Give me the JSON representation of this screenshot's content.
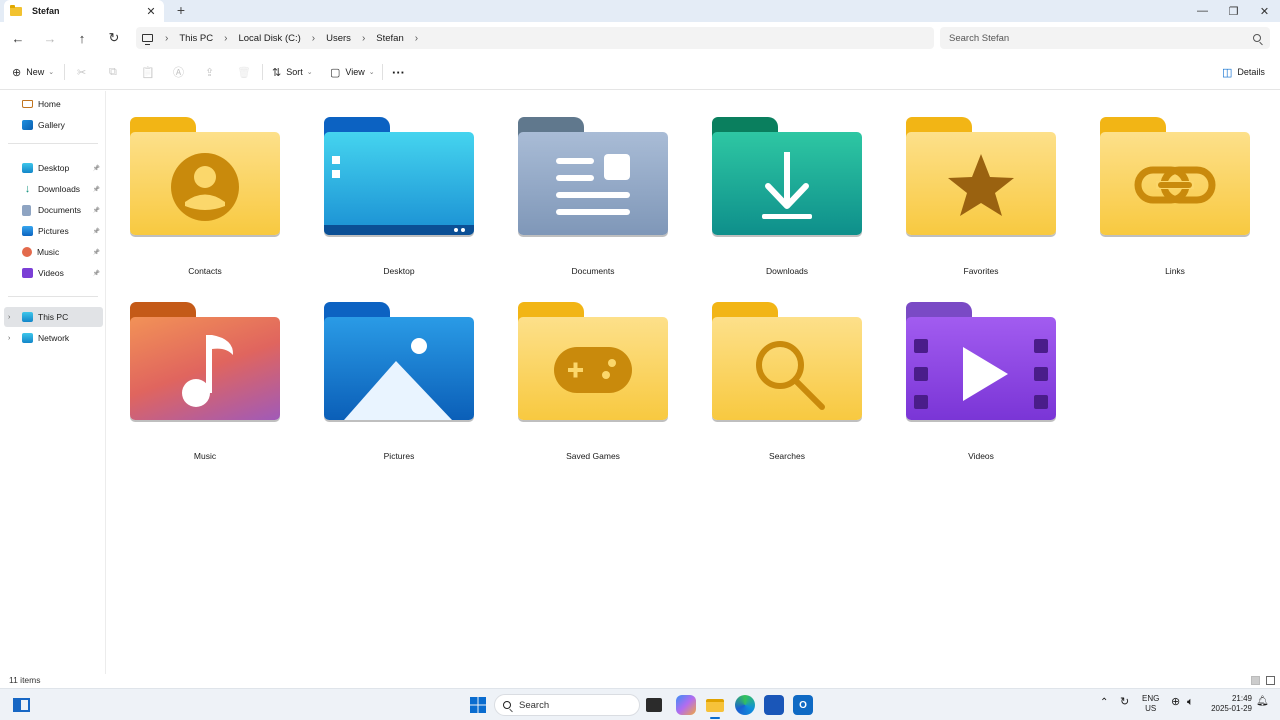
{
  "window": {
    "tab_title": "Stefan",
    "tab_close": "✕",
    "new_tab": "+",
    "minimize": "—",
    "maximize": "❐",
    "close": "✕"
  },
  "address_bar": {
    "back": "←",
    "forward": "→",
    "up": "↑",
    "refresh": "↻",
    "breadcrumbs": [
      "This PC",
      "Local Disk (C:)",
      "Users",
      "Stefan"
    ],
    "separator": "›",
    "search_placeholder": "Search Stefan"
  },
  "command_bar": {
    "new_label": "New",
    "sort_label": "Sort",
    "view_label": "View",
    "more": "···",
    "details_label": "Details",
    "icons": {
      "new": "⊕",
      "cut": "✂",
      "copy": "⧉",
      "paste": "📋",
      "rename": "Ⓐ",
      "share": "⇪",
      "delete": "🗑",
      "sort": "⇅",
      "view": "▢",
      "details": "◫"
    }
  },
  "nav_pane": {
    "home": "Home",
    "gallery": "Gallery",
    "quick_access": [
      "Desktop",
      "Downloads",
      "Documents",
      "Pictures",
      "Music",
      "Videos"
    ],
    "this_pc": "This PC",
    "network": "Network",
    "pin": "📌",
    "expander": "›"
  },
  "folders": [
    {
      "name": "Contacts",
      "icon": "contacts-icon"
    },
    {
      "name": "Desktop",
      "icon": "desktop-icon"
    },
    {
      "name": "Documents",
      "icon": "documents-icon"
    },
    {
      "name": "Downloads",
      "icon": "downloads-icon"
    },
    {
      "name": "Favorites",
      "icon": "star-icon"
    },
    {
      "name": "Links",
      "icon": "link-icon"
    },
    {
      "name": "Music",
      "icon": "music-icon"
    },
    {
      "name": "Pictures",
      "icon": "pictures-icon"
    },
    {
      "name": "Saved Games",
      "icon": "gamepad-icon"
    },
    {
      "name": "Searches",
      "icon": "search-icon"
    },
    {
      "name": "Videos",
      "icon": "video-icon"
    }
  ],
  "status": {
    "item_count": "11 items"
  },
  "taskbar": {
    "search_label": "Search",
    "lang_top": "ENG",
    "lang_bottom": "US",
    "time": "21:49",
    "date": "2025-01-29",
    "tray_chevron": "⌃"
  },
  "colors": {
    "accent": "#0a6ccf",
    "folder_yellow": "#f6c744",
    "selected_nav": "#e1e3e6"
  }
}
